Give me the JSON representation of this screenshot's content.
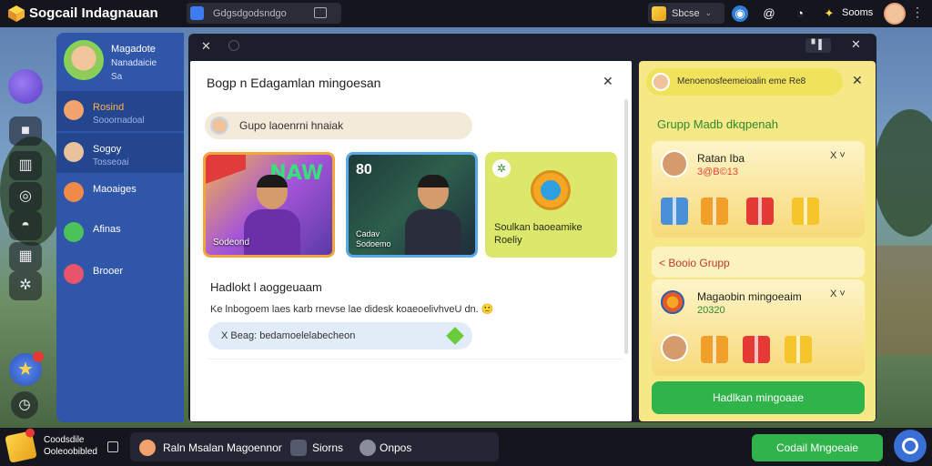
{
  "app": {
    "title": "Sogcail Indagnauan"
  },
  "topbar": {
    "search_text": "Gdgsdgodsndgo",
    "store_label": "Sbcse",
    "coins_label": "Sooms"
  },
  "sidebar": {
    "profile": {
      "name": "Magadote",
      "sub1": "Nanadaicie",
      "sub2": "Sa"
    },
    "items": [
      {
        "label": "Rosind",
        "sub": "Sooornadoal",
        "icon": "person-icon"
      },
      {
        "label": "Sogoy",
        "sub": "Tosseoai",
        "icon": "person-icon"
      },
      {
        "label": "Maoaiges",
        "sub": "",
        "icon": "group-icon"
      },
      {
        "label": "Afinas",
        "sub": "",
        "icon": "link-icon"
      },
      {
        "label": "Brooer",
        "sub": "",
        "icon": "calendar-icon"
      }
    ]
  },
  "center": {
    "title": "Bogp n Edagamlan mingoesan",
    "search_text": "Gupo laoenrni hnaiak",
    "cards": [
      {
        "label": "Sodeond",
        "badge": "",
        "new_text": "NAW"
      },
      {
        "number": "80",
        "label": "Cadav\nSodoemo"
      },
      {
        "label": "Soulkan baoeamike\nRoeliy"
      }
    ],
    "section_title": "Hadlokt l aoggeuaam",
    "section_body": "Ke lnbogoem laes karb rnevse lae didesk koaeoelivhveU dn. 🙂",
    "pill_text": "X Beag: bedamoelelabecheon"
  },
  "right": {
    "header_text": "Menoenosfeemeioalin eme Re8",
    "group_title": "Grupp Madb dkqpenah",
    "card1": {
      "name": "Ratan Iba",
      "sub": "3@B©13",
      "close": "X ˅"
    },
    "section2_title": "< Booio Grupp",
    "card2": {
      "name": "Magaobin mingoeaim",
      "sub": "20320",
      "close": "X ˅"
    },
    "button_label": "Hadlkan mingoaae"
  },
  "bottombar": {
    "text1": "Coodsdile",
    "text2": "Ooleoobibled",
    "tab1": "Raln Msalan Magoennor",
    "tab2": "Siorns",
    "tab3": "Onpos",
    "button_label": "Codail Mngoeaie"
  },
  "colors": {
    "accent_green": "#2fb34a",
    "sidebar_blue": "#2f56a8",
    "right_panel_yellow": "#f6e886",
    "alert_red": "#e53935"
  }
}
